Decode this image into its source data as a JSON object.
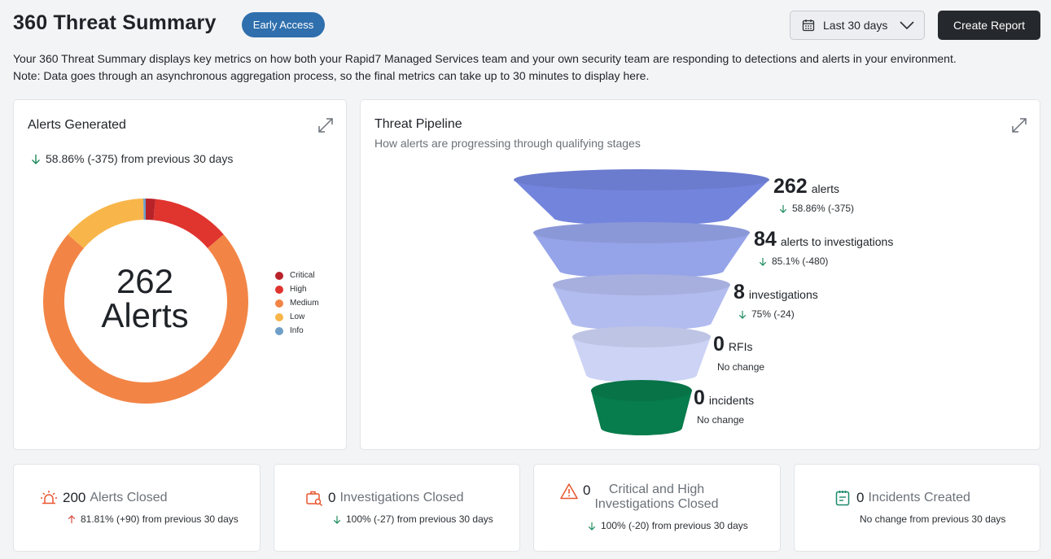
{
  "header": {
    "title": "360 Threat Summary",
    "badge": "Early Access",
    "date_range": "Last 30 days",
    "create_report": "Create Report",
    "description_line1": "Your 360 Threat Summary displays key metrics on how both your Rapid7 Managed Services team and your own security team are responding to detections and alerts in your environment.",
    "description_line2": "Note: Data goes through an asynchronous aggregation process, so the final metrics can take up to 30 minutes to display here."
  },
  "alerts_card": {
    "title": "Alerts Generated",
    "delta": "58.86% (-375) from previous 30 days",
    "center_value": "262",
    "center_label": "Alerts"
  },
  "pipeline_card": {
    "title": "Threat Pipeline",
    "subtitle": "How alerts are progressing through qualifying stages",
    "stages": [
      {
        "value": "262",
        "label": "alerts",
        "delta": "58.86% (-375)",
        "direction": "down",
        "color": "#7384dd"
      },
      {
        "value": "84",
        "label": "alerts to investigations",
        "delta": "85.1% (-480)",
        "direction": "down",
        "color": "#95a3e8"
      },
      {
        "value": "8",
        "label": "investigations",
        "delta": "75% (-24)",
        "direction": "down",
        "color": "#b2bcef"
      },
      {
        "value": "0",
        "label": "RFIs",
        "delta": "No change",
        "direction": "none",
        "color": "#ccd3f5"
      },
      {
        "value": "0",
        "label": "incidents",
        "delta": "No change",
        "direction": "none",
        "color": "#077c4c"
      }
    ]
  },
  "stats": [
    {
      "value": "200",
      "label": "Alerts Closed",
      "delta": "81.81% (+90) from previous 30 days",
      "direction": "up",
      "icon": "siren-icon"
    },
    {
      "value": "0",
      "label": "Investigations Closed",
      "delta": "100% (-27) from previous 30 days",
      "direction": "down",
      "icon": "briefcase-search-icon"
    },
    {
      "value": "0",
      "label_line1": "Critical and High",
      "label_line2": "Investigations Closed",
      "delta": "100% (-20) from previous 30 days",
      "direction": "down",
      "icon": "warning-icon"
    },
    {
      "value": "0",
      "label": "Incidents Created",
      "delta": "No change from previous 30 days",
      "direction": "none",
      "icon": "notepad-icon"
    }
  ],
  "chart_data": {
    "type": "pie",
    "categories": [
      "Critical",
      "High",
      "Medium",
      "Low",
      "Info"
    ],
    "values": [
      4,
      32,
      190,
      35,
      1
    ],
    "colors": [
      "#b8232a",
      "#e0342f",
      "#f28546",
      "#f8b64a",
      "#6f9fc8"
    ],
    "legend": "right"
  }
}
